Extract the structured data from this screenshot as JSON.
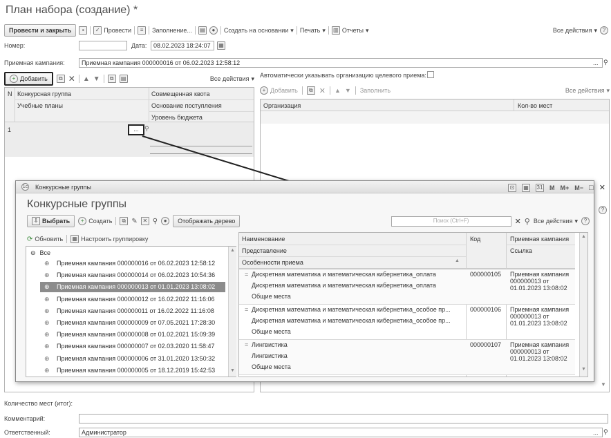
{
  "doc_title": "План набора (создание) *",
  "toolbar": {
    "post_close": "Провести и закрыть",
    "post": "Провести",
    "fill": "Заполнение...",
    "create_based": "Создать на основании",
    "print": "Печать",
    "reports": "Отчеты",
    "all_actions": "Все действия",
    "help": "?"
  },
  "header": {
    "number_label": "Номер:",
    "number_value": "",
    "date_label": "Дата:",
    "date_value": "08.02.2023 18:24:07",
    "campaign_label": "Приемная кампания:",
    "campaign_value": "Приемная кампания 000000016 от 06.02.2023 12:58:12",
    "auto_org_label": "Автоматически указывать организацию целевого приема:"
  },
  "left_table": {
    "add": "Добавить",
    "all_actions": "Все действия",
    "col_n": "N",
    "col_group": "Конкурсная группа",
    "col_plans": "Учебные планы",
    "col_quota": "Совмещенная квота",
    "col_basis": "Основание поступления",
    "col_budget": "Уровень бюджета",
    "row_n": "1",
    "row_cell_button": "..."
  },
  "right_table": {
    "add": "Добавить",
    "fill": "Заполнить",
    "all_actions": "Все действия",
    "col_org": "Организация",
    "col_places": "Кол-во мест"
  },
  "footer": {
    "places_total_label": "Количество мест (итог):",
    "comment_label": "Комментарий:",
    "responsible_label": "Ответственный:",
    "responsible_value": "Администратор"
  },
  "dialog": {
    "window_title": "Конкурсные группы",
    "heading": "Конкурсные группы",
    "select": "Выбрать",
    "create": "Создать",
    "show_tree": "Отображать дерево",
    "search_placeholder": "Поиск (Ctrl+F)",
    "all_actions": "Все действия",
    "refresh": "Обновить",
    "grouping": "Настроить группировку",
    "tree_root": "Все",
    "tree_items": [
      "Приемная кампания 000000016 от 06.02.2023 12:58:12",
      "Приемная кампания 000000014 от 06.02.2023 10:54:36",
      "Приемная кампания 000000013 от 01.01.2023 13:08:02",
      "Приемная кампания 000000012 от 16.02.2022 11:16:06",
      "Приемная кампания 000000011 от 16.02.2022 11:16:08",
      "Приемная кампания 000000009 от 07.05.2021 17:28:30",
      "Приемная кампания 000000008 от 01.02.2021 15:09:39",
      "Приемная кампания 000000007 от 02.03.2020 11:58:47",
      "Приемная кампания 000000006 от 31.01.2020 13:50:32",
      "Приемная кампания 000000005 от 18.12.2019 15:42:53"
    ],
    "selected_index": 2,
    "col_name": "Наименование",
    "col_view": "Представление",
    "col_features": "Особенности приема",
    "col_code": "Код",
    "col_campaign": "Приемная кампания",
    "col_link": "Ссылка",
    "rows": [
      {
        "name": "Дискретная математика и математическая кибернетика_оплата",
        "view": "Дискретная математика и математическая кибернетика_оплата",
        "features": "Общие места",
        "code": "000000105",
        "campaign_l1": "Приемная кампания",
        "campaign_l2": "000000013 от",
        "campaign_l3": "01.01.2023 13:08:02"
      },
      {
        "name": "Дискретная математика и математическая кибернетика_особое пр...",
        "view": "Дискретная математика и математическая кибернетика_особое пр...",
        "features": "Общие места",
        "code": "000000106",
        "campaign_l1": "Приемная кампания",
        "campaign_l2": "000000013 от",
        "campaign_l3": "01.01.2023 13:08:02"
      },
      {
        "name": "Лингвистика",
        "view": "Лингвистика",
        "features": "Общие места",
        "code": "000000107",
        "campaign_l1": "Приемная кампания",
        "campaign_l2": "000000013 от",
        "campaign_l3": "01.01.2023 13:08:02"
      }
    ]
  }
}
